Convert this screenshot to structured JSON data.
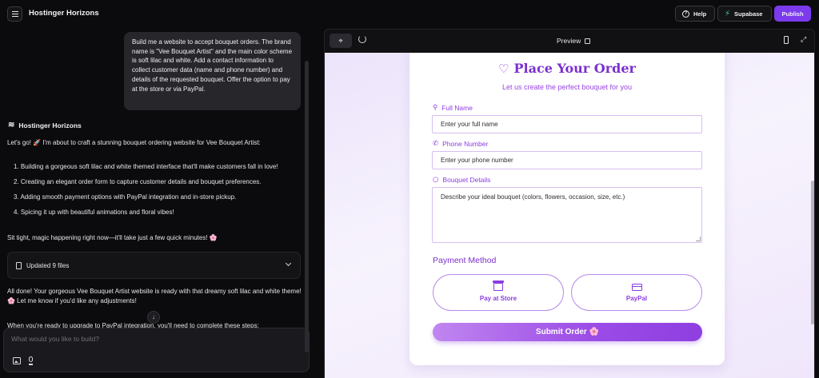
{
  "topbar": {
    "app_title": "Hostinger Horizons",
    "help_label": "Help",
    "supabase_label": "Supabase",
    "publish_label": "Publish",
    "colors": {
      "accent": "#7c3aed",
      "supabase_bolt": "#3ecf8e"
    }
  },
  "chat": {
    "user_message": "Build me a website to accept bouquet orders. The brand name is \"Vee Bouquet Artist\" and the main color scheme is soft lilac and white. Add a contact information to collect customer data (name and phone number) and details of the requested bouquet. Offer the option to pay at the store or via PayPal.",
    "bot_name": "Hostinger Horizons",
    "intro": "Let's go! 🚀 I'm about to craft a stunning bouquet ordering website for Vee Bouquet Artist:",
    "steps": [
      "1. Building a gorgeous soft lilac and white themed interface that'll make customers fall in love!",
      "2. Creating an elegant order form to capture customer details and bouquet preferences.",
      "3. Adding smooth payment options with PayPal integration and in-store pickup.",
      "4. Spicing it up with beautiful animations and floral vibes!"
    ],
    "wait_message": "Sit tight, magic happening right now—it'll take just a few quick minutes! 🌸",
    "files_label": "Updated 9 files",
    "done_message": "All done! Your gorgeous Vee Bouquet Artist website is ready with that dreamy soft lilac and white theme! 🌸 Let me know if you'd like any adjustments!",
    "next_message": "When you're ready to upgrade to PayPal integration, you'll need to complete these steps:",
    "prompt_placeholder": "What would you like to build?"
  },
  "preview": {
    "label": "Preview",
    "form": {
      "title": "Place Your Order",
      "subtitle": "Let us create the perfect bouquet for you",
      "name_label": "Full Name",
      "name_placeholder": "Enter your full name",
      "phone_label": "Phone Number",
      "phone_placeholder": "Enter your phone number",
      "details_label": "Bouquet Details",
      "details_placeholder": "Describe your ideal bouquet (colors, flowers, occasion, size, etc.)",
      "payment_title": "Payment Method",
      "pay_store_label": "Pay at Store",
      "pay_paypal_label": "PayPal",
      "submit_label": "Submit Order 🌸"
    },
    "colors": {
      "primary": "#8b3ddf",
      "background": "#f3edfc"
    }
  }
}
